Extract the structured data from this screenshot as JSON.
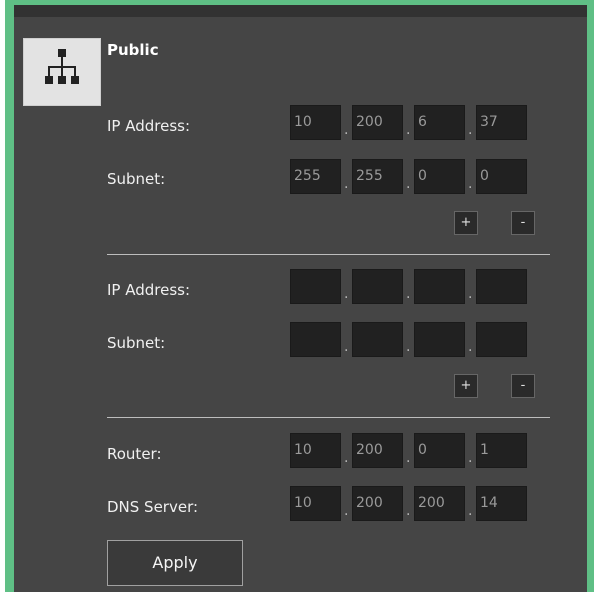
{
  "section": {
    "title": "Public",
    "icon": "network-icon"
  },
  "interfaces": [
    {
      "ip_label": "IP Address:",
      "ip": [
        "10",
        "200",
        "6",
        "37"
      ],
      "subnet_label": "Subnet:",
      "subnet": [
        "255",
        "255",
        "0",
        "0"
      ],
      "add_label": "+",
      "remove_label": "-"
    },
    {
      "ip_label": "IP Address:",
      "ip": [
        "",
        "",
        "",
        ""
      ],
      "subnet_label": "Subnet:",
      "subnet": [
        "",
        "",
        "",
        ""
      ],
      "add_label": "+",
      "remove_label": "-"
    }
  ],
  "router": {
    "label": "Router:",
    "octets": [
      "10",
      "200",
      "0",
      "1"
    ]
  },
  "dns": {
    "label": "DNS Server:",
    "octets": [
      "10",
      "200",
      "200",
      "14"
    ]
  },
  "apply_label": "Apply",
  "separator": ".",
  "colors": {
    "accent_green": "#5fbf85",
    "panel": "#454545",
    "field": "#212121"
  }
}
